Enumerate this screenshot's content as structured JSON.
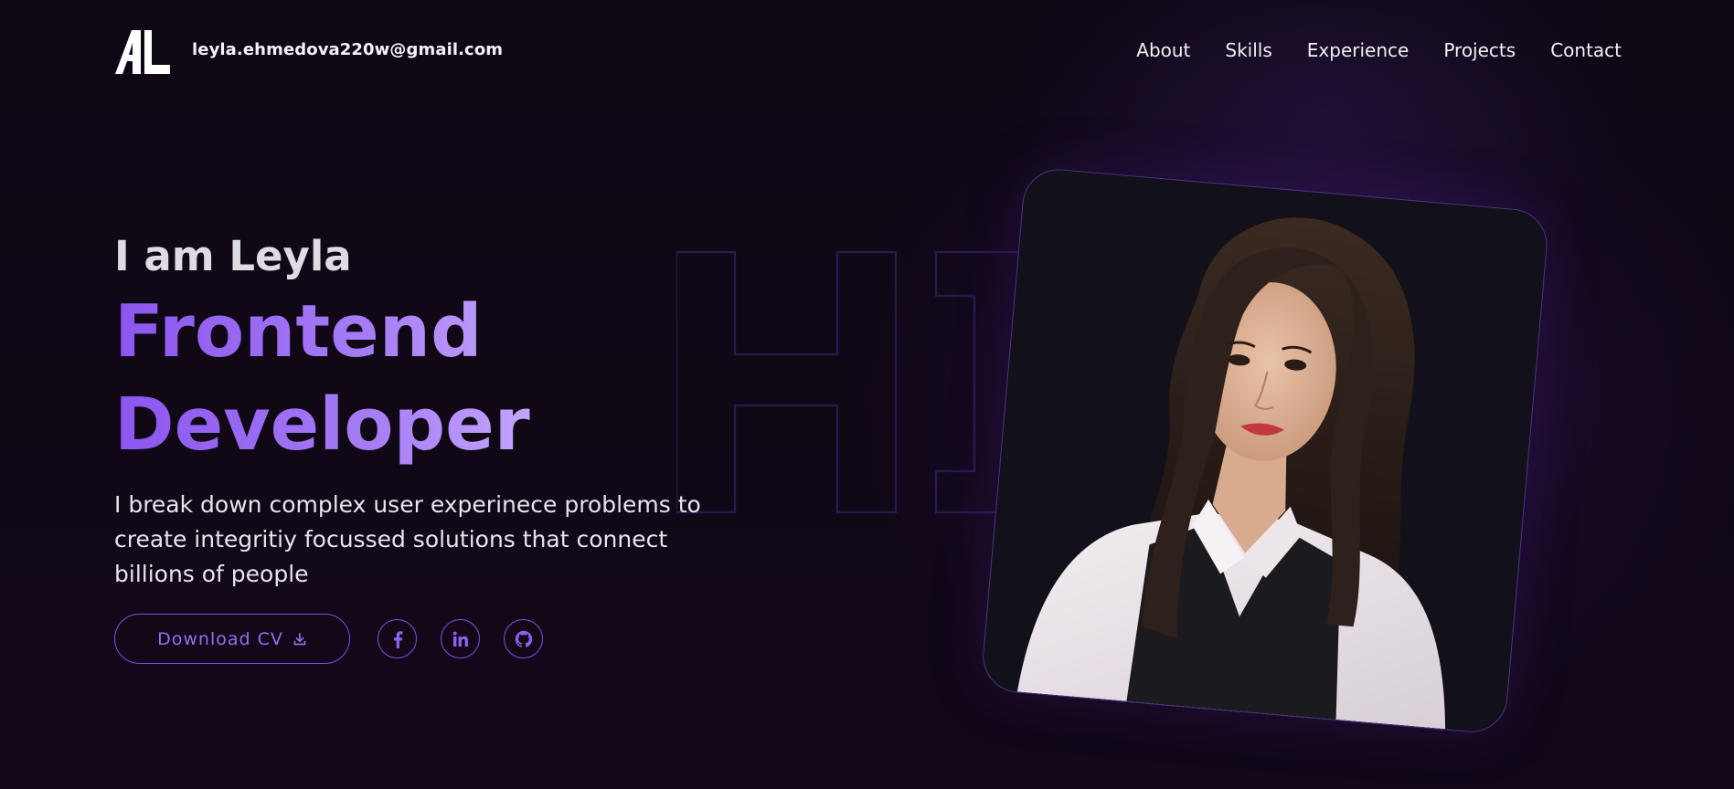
{
  "header": {
    "logo_text": "AL",
    "email": "leyla.ehmedova220w@gmail.com",
    "nav": [
      {
        "label": "About"
      },
      {
        "label": "Skills"
      },
      {
        "label": "Experience"
      },
      {
        "label": "Projects"
      },
      {
        "label": "Contact"
      }
    ]
  },
  "hero": {
    "greeting": "I am Leyla",
    "role": "Frontend Developer",
    "description": "I break down complex user experinece problems to create integritiy focussed solutions that connect billions of people",
    "background_text": "HI",
    "download_label": "Download CV",
    "socials": [
      {
        "name": "facebook",
        "icon": "facebook-icon"
      },
      {
        "name": "linkedin",
        "icon": "linkedin-icon"
      },
      {
        "name": "github",
        "icon": "github-icon"
      }
    ]
  },
  "colors": {
    "accent": "#8b55ef",
    "accent_light": "#c4a6fb",
    "background": "#0e0714",
    "text": "#ffffff"
  }
}
